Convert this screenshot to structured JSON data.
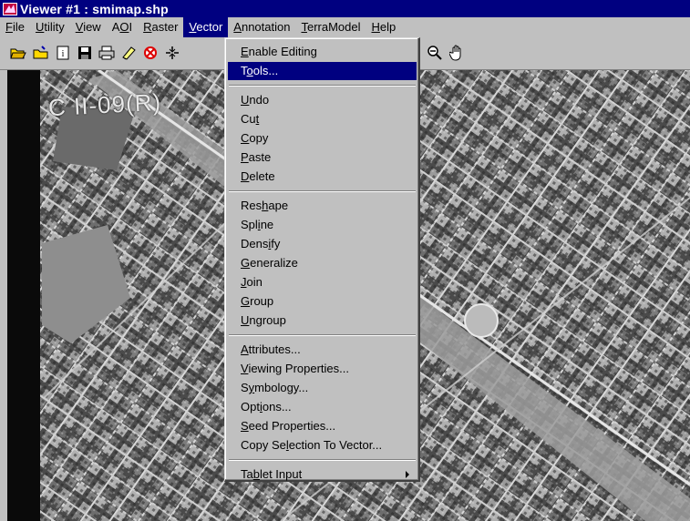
{
  "window": {
    "title": "Viewer #1 : smimap.shp"
  },
  "menubar": [
    {
      "pre": "",
      "key": "F",
      "post": "ile"
    },
    {
      "pre": "",
      "key": "U",
      "post": "tility"
    },
    {
      "pre": "",
      "key": "V",
      "post": "iew"
    },
    {
      "pre": "A",
      "key": "O",
      "post": "I"
    },
    {
      "pre": "",
      "key": "R",
      "post": "aster"
    },
    {
      "pre": "",
      "key": "V",
      "post": "ector",
      "active": true
    },
    {
      "pre": "",
      "key": "A",
      "post": "nnotation"
    },
    {
      "pre": "",
      "key": "T",
      "post": "erraModel"
    },
    {
      "pre": "",
      "key": "H",
      "post": "elp"
    }
  ],
  "toolbar": {
    "icons": [
      "open-folder-icon",
      "open-folder-alt-icon",
      "info-icon",
      "save-icon",
      "print-icon",
      "erase-icon",
      "clear-icon",
      "fit-icon",
      "zoom-out-icon",
      "pan-hand-icon"
    ]
  },
  "map": {
    "image_label": "C II-09(R)"
  },
  "vector_menu": {
    "groups": [
      [
        {
          "pre": "",
          "key": "E",
          "post": "nable Editing"
        },
        {
          "pre": "T",
          "key": "o",
          "post": "ols...",
          "highlighted": true
        }
      ],
      [
        {
          "pre": "",
          "key": "U",
          "post": "ndo"
        },
        {
          "pre": "Cu",
          "key": "t",
          "post": ""
        },
        {
          "pre": "",
          "key": "C",
          "post": "opy"
        },
        {
          "pre": "",
          "key": "P",
          "post": "aste"
        },
        {
          "pre": "",
          "key": "D",
          "post": "elete"
        }
      ],
      [
        {
          "pre": "Res",
          "key": "h",
          "post": "ape"
        },
        {
          "pre": "Spl",
          "key": "i",
          "post": "ne"
        },
        {
          "pre": "Dens",
          "key": "i",
          "post": "fy"
        },
        {
          "pre": "",
          "key": "G",
          "post": "eneralize"
        },
        {
          "pre": "",
          "key": "J",
          "post": "oin"
        },
        {
          "pre": "",
          "key": "G",
          "post": "roup"
        },
        {
          "pre": "",
          "key": "U",
          "post": "ngroup"
        }
      ],
      [
        {
          "pre": "",
          "key": "A",
          "post": "ttributes..."
        },
        {
          "pre": "",
          "key": "V",
          "post": "iewing Properties..."
        },
        {
          "pre": "S",
          "key": "y",
          "post": "mbology..."
        },
        {
          "pre": "Opt",
          "key": "i",
          "post": "ons..."
        },
        {
          "pre": "",
          "key": "S",
          "post": "eed Properties..."
        },
        {
          "pre": "Copy Se",
          "key": "l",
          "post": "ection To Vector..."
        }
      ],
      [
        {
          "pre": "Ta",
          "key": "b",
          "post": "let Input",
          "submenu": true
        }
      ]
    ]
  },
  "colors": {
    "titlebar": "#000080",
    "menu_bg": "#c0c0c0",
    "highlight": "#000080"
  }
}
